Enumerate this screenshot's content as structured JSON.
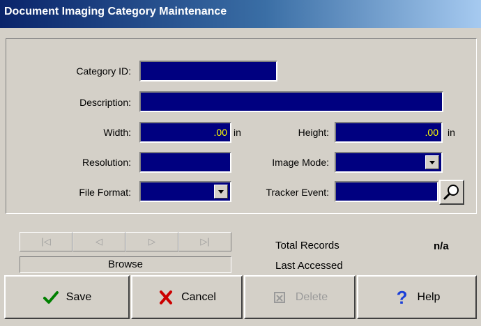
{
  "window": {
    "title": "Document Imaging Category Maintenance"
  },
  "form": {
    "category_id": {
      "label": "Category ID:",
      "value": ""
    },
    "description": {
      "label": "Description:",
      "value": ""
    },
    "width": {
      "label": "Width:",
      "value": ".00",
      "unit": "in"
    },
    "height": {
      "label": "Height:",
      "value": ".00",
      "unit": "in"
    },
    "resolution": {
      "label": "Resolution:",
      "value": ""
    },
    "image_mode": {
      "label": "Image Mode:",
      "value": ""
    },
    "file_format": {
      "label": "File Format:",
      "value": ""
    },
    "tracker_event": {
      "label": "Tracker Event:",
      "value": ""
    }
  },
  "navigation": {
    "first": "|◁",
    "prev": "◁",
    "next": "▷",
    "last": "▷|",
    "mode": "Browse"
  },
  "info": {
    "total_records_label": "Total Records",
    "total_records_value": "n/a",
    "last_accessed_label": "Last Accessed"
  },
  "buttons": {
    "save": "Save",
    "cancel": "Cancel",
    "delete": "Delete",
    "help": "Help"
  },
  "colors": {
    "field_bg": "#000080",
    "field_text": "#ffff00",
    "face": "#d4d0c8",
    "title_start": "#0a246a",
    "title_end": "#a6caf0"
  },
  "icons": {
    "save": "checkmark-icon",
    "cancel": "x-icon",
    "delete": "delete-icon",
    "help": "question-icon",
    "lookup": "magnifier-icon"
  }
}
